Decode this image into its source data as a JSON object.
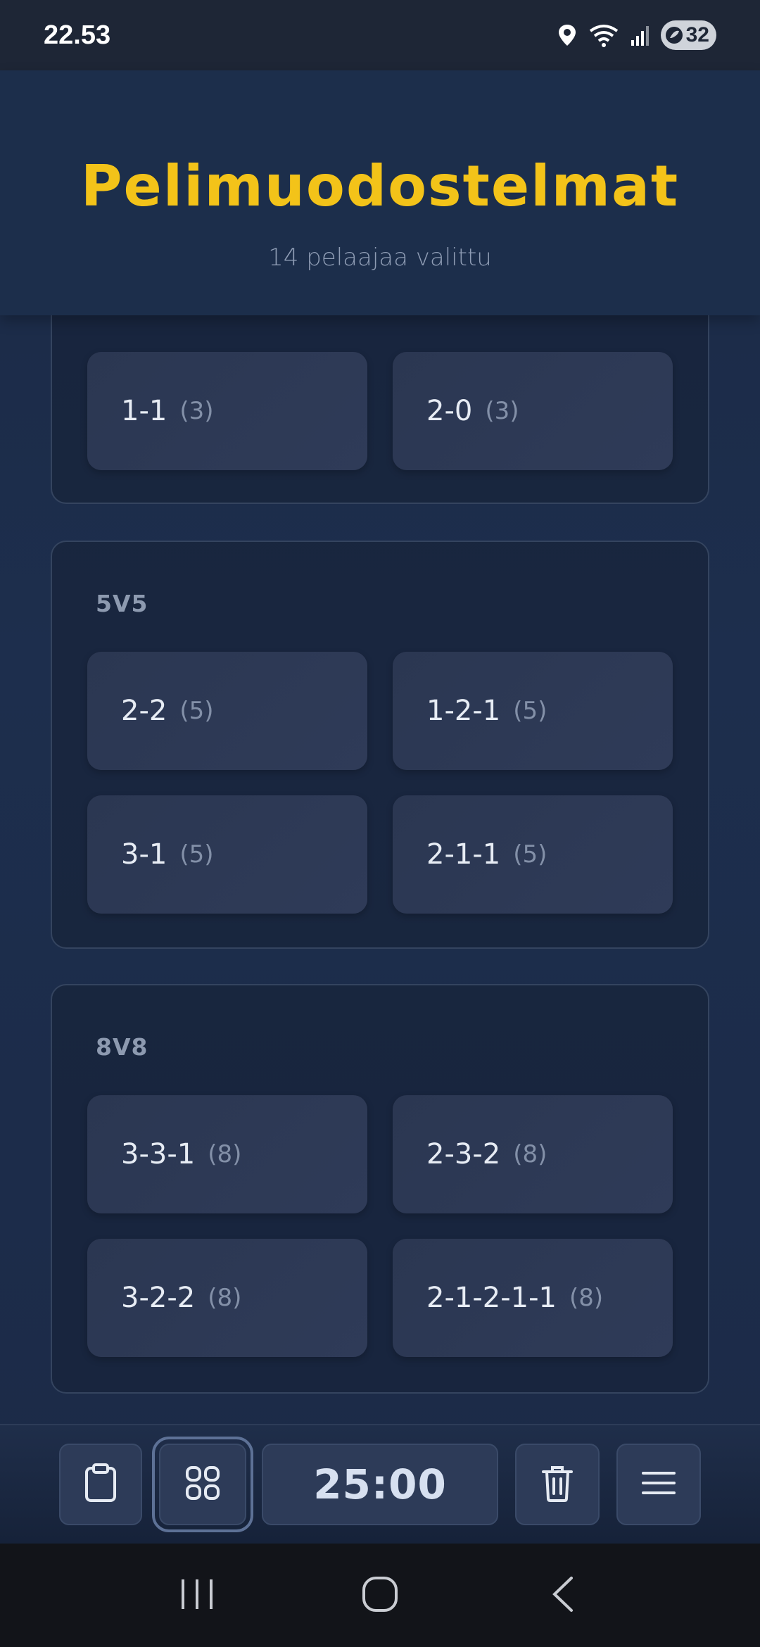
{
  "status_bar": {
    "time": "22.53",
    "battery": "32",
    "icons": [
      "location-icon",
      "wifi-icon",
      "signal-icon",
      "battery-icon"
    ]
  },
  "header": {
    "title": "Pelimuodostelmat",
    "subtitle": "14 pelaajaa valittu"
  },
  "groups": [
    {
      "title": "",
      "formations": [
        {
          "label": "1-1",
          "count": "(3)"
        },
        {
          "label": "2-0",
          "count": "(3)"
        }
      ]
    },
    {
      "title": "5V5",
      "formations": [
        {
          "label": "2-2",
          "count": "(5)"
        },
        {
          "label": "1-2-1",
          "count": "(5)"
        },
        {
          "label": "3-1",
          "count": "(5)"
        },
        {
          "label": "2-1-1",
          "count": "(5)"
        }
      ]
    },
    {
      "title": "8V8",
      "formations": [
        {
          "label": "3-3-1",
          "count": "(8)"
        },
        {
          "label": "2-3-2",
          "count": "(8)"
        },
        {
          "label": "3-2-2",
          "count": "(8)"
        },
        {
          "label": "2-1-2-1-1",
          "count": "(8)"
        }
      ]
    }
  ],
  "toolbar": {
    "timer": "25:00",
    "buttons": [
      "clipboard-icon",
      "grid-icon",
      "timer",
      "trash-icon",
      "menu-icon"
    ],
    "active_button": "grid-icon"
  },
  "colors": {
    "accent_title": "#f3c319",
    "background": "#1b2a45",
    "tile": "#2d3a56"
  }
}
